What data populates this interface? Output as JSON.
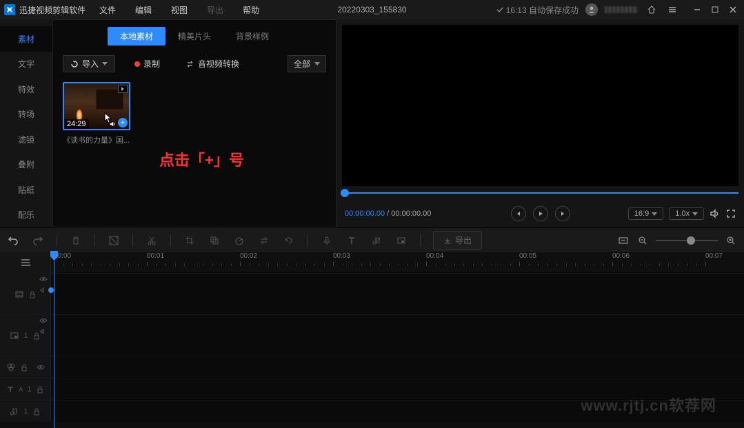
{
  "app": {
    "title": "迅捷视频剪辑软件",
    "doc_title": "20220303_155830",
    "autosave": "16:13 自动保存成功"
  },
  "menu": {
    "file": "文件",
    "edit": "编辑",
    "view": "视图",
    "export": "导出",
    "help": "帮助"
  },
  "side_tabs": {
    "material": "素材",
    "text": "文字",
    "effects": "特效",
    "transition": "转场",
    "filter": "滤镜",
    "overlay": "叠附",
    "sticker": "贴纸",
    "music": "配乐"
  },
  "sub_tabs": {
    "local": "本地素材",
    "clips": "精美片头",
    "sample": "背景样例"
  },
  "toolbar": {
    "import": "导入",
    "record": "录制",
    "convert": "音视频转换",
    "filter_all": "全部"
  },
  "media": {
    "duration": "24:29",
    "name": "《读书的力量》国..."
  },
  "annotation": "点击「+」号",
  "preview": {
    "current": "00:00:00.00",
    "sep": " / ",
    "total": "00:00:00.00",
    "ratio": "16:9",
    "speed": "1.0x"
  },
  "strip": {
    "export": "导出"
  },
  "ruler": {
    "ticks": [
      "00:00",
      "00:01",
      "00:02",
      "00:03",
      "00:04",
      "00:05",
      "00:06",
      "00:07"
    ]
  },
  "tracks": {
    "t1_num": "1",
    "t2_num": "1"
  },
  "watermark": "www.rjtj.cn软荐网"
}
